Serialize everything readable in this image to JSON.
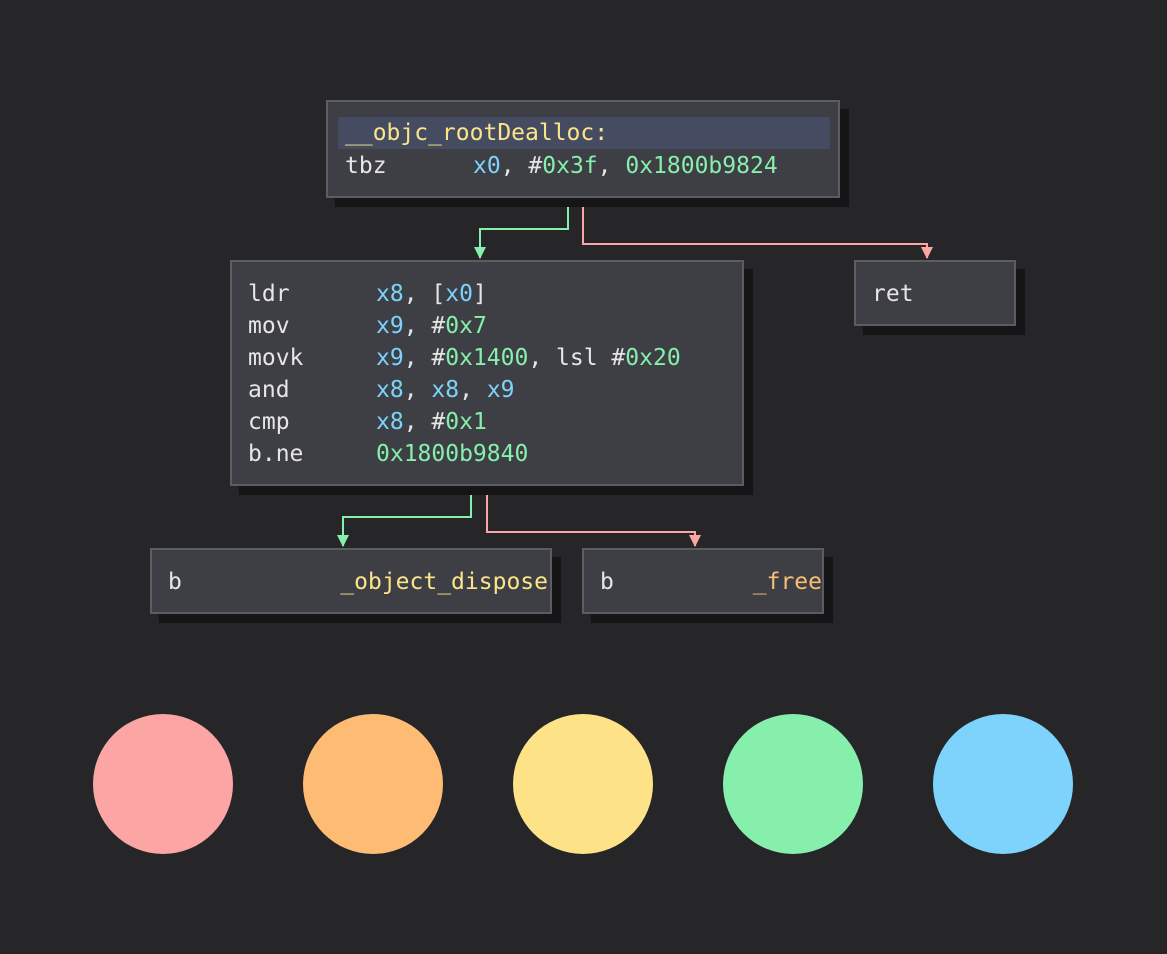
{
  "nodes": {
    "entry": {
      "label": "__objc_rootDealloc:",
      "instructions": [
        {
          "op": "tbz",
          "args": [
            {
              "t": "x0",
              "k": "reg"
            },
            {
              "t": ", #",
              "k": "punct"
            },
            {
              "t": "0x3f",
              "k": "imm"
            },
            {
              "t": ", ",
              "k": "punct"
            },
            {
              "t": "0x1800b9824",
              "k": "imm"
            }
          ]
        }
      ]
    },
    "check": {
      "instructions": [
        {
          "op": "ldr",
          "args": [
            {
              "t": "x8",
              "k": "reg"
            },
            {
              "t": ", [",
              "k": "punct"
            },
            {
              "t": "x0",
              "k": "reg"
            },
            {
              "t": "]",
              "k": "punct"
            }
          ]
        },
        {
          "op": "mov",
          "args": [
            {
              "t": "x9",
              "k": "reg"
            },
            {
              "t": ", #",
              "k": "punct"
            },
            {
              "t": "0x7",
              "k": "imm"
            }
          ]
        },
        {
          "op": "movk",
          "args": [
            {
              "t": "x9",
              "k": "reg"
            },
            {
              "t": ", #",
              "k": "punct"
            },
            {
              "t": "0x1400",
              "k": "imm"
            },
            {
              "t": ", lsl #",
              "k": "punct"
            },
            {
              "t": "0x20",
              "k": "imm"
            }
          ]
        },
        {
          "op": "and",
          "args": [
            {
              "t": "x8",
              "k": "reg"
            },
            {
              "t": ", ",
              "k": "punct"
            },
            {
              "t": "x8",
              "k": "reg"
            },
            {
              "t": ", ",
              "k": "punct"
            },
            {
              "t": "x9",
              "k": "reg"
            }
          ]
        },
        {
          "op": "cmp",
          "args": [
            {
              "t": "x8",
              "k": "reg"
            },
            {
              "t": ", #",
              "k": "punct"
            },
            {
              "t": "0x1",
              "k": "imm"
            }
          ]
        },
        {
          "op": "b.ne",
          "args": [
            {
              "t": "0x1800b9840",
              "k": "imm"
            }
          ]
        }
      ]
    },
    "ret": {
      "instructions": [
        {
          "op": "ret",
          "args": []
        }
      ]
    },
    "dispose": {
      "instructions": [
        {
          "op": "b",
          "args": [
            {
              "t": "_object_dispose",
              "k": "sym2"
            }
          ]
        }
      ]
    },
    "free": {
      "instructions": [
        {
          "op": "b",
          "args": [
            {
              "t": "_free",
              "k": "sym"
            }
          ]
        }
      ]
    }
  },
  "edges": [
    {
      "from": "entry",
      "to": "check",
      "type": "true",
      "color": "#86efac"
    },
    {
      "from": "entry",
      "to": "ret",
      "type": "false",
      "color": "#fca5a5"
    },
    {
      "from": "check",
      "to": "dispose",
      "type": "true",
      "color": "#86efac"
    },
    {
      "from": "check",
      "to": "free",
      "type": "false",
      "color": "#fca5a5"
    }
  ],
  "palette": [
    "#fca5a5",
    "#fdbb74",
    "#fde288",
    "#86efac",
    "#7dd3fc"
  ]
}
